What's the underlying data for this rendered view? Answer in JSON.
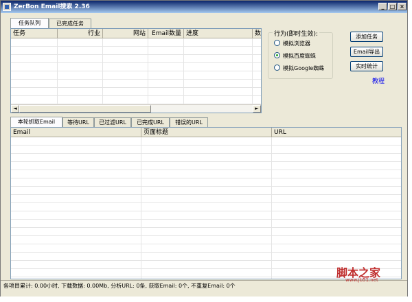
{
  "window": {
    "title": "ZerBon Email搜索 2.36"
  },
  "title_buttons": {
    "minimize": "_",
    "maximize": "□",
    "close": "×"
  },
  "top_tabs": [
    {
      "label": "任务队列",
      "active": true
    },
    {
      "label": "已完成任务",
      "active": false
    }
  ],
  "task_table": {
    "columns": [
      "任务",
      "行业",
      "网站",
      "Email数量",
      "进度",
      "数"
    ]
  },
  "scroll": {
    "left": "◄",
    "right": "►"
  },
  "behavior": {
    "legend": "行为(即时生效):",
    "options": [
      {
        "label": "模拟浏览器",
        "checked": false
      },
      {
        "label": "模拟百度蜘蛛",
        "checked": true
      },
      {
        "label": "模拟Google蜘蛛",
        "checked": false
      }
    ]
  },
  "buttons": {
    "add_task": "添加任务",
    "export_email": "Email导出",
    "realtime_stats": "实时统计"
  },
  "tutorial_link": "教程",
  "bottom_tabs": [
    {
      "label": "本轮抓取Email",
      "active": true
    },
    {
      "label": "等待URL",
      "active": false
    },
    {
      "label": "已过滤URL",
      "active": false
    },
    {
      "label": "已完成URL",
      "active": false
    },
    {
      "label": "错误的URL",
      "active": false
    }
  ],
  "email_table": {
    "columns": [
      "Email",
      "页面标题",
      "URL"
    ]
  },
  "status": {
    "text": "各项目累计: 0.00小时, 下载数据: 0.00Mb, 分析URL: 0条, 获取Email: 0个, 不重复Email: 0个"
  },
  "watermark": {
    "text": "脚本之家",
    "url": "www.jb51.net"
  }
}
